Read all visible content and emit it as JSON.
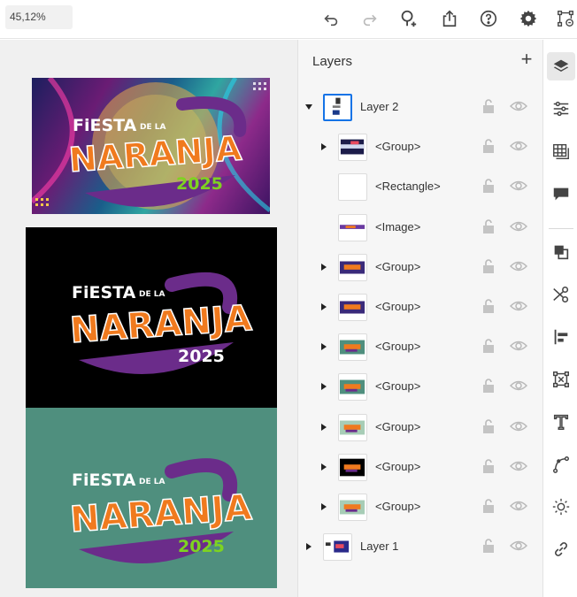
{
  "toolbar": {
    "zoom_value": "45,12%",
    "icons": [
      "undo-icon",
      "redo-icon",
      "add-user-icon",
      "share-icon",
      "help-icon",
      "settings-icon",
      "path-select-icon"
    ]
  },
  "artboards": {
    "poster1": {
      "line1": "FiESTA",
      "line1_small": "DE LA",
      "line2": "NARANJA",
      "line3": "2025"
    },
    "poster2": {
      "line1": "FiESTA",
      "line1_small": "DE LA",
      "line2": "NARANJA",
      "line3": "2025"
    },
    "poster3": {
      "line1": "FiESTA",
      "line1_small": "DE LA",
      "line2": "NARANJA",
      "line3": "2025"
    }
  },
  "layers": {
    "title": "Layers",
    "add_icon": "plus-icon",
    "rows": [
      {
        "label": "Layer 2",
        "indent": 0,
        "expanded": true,
        "has_chevron": true,
        "selected": true,
        "thumb": "layer2"
      },
      {
        "label": "<Group>",
        "indent": 1,
        "expanded": false,
        "has_chevron": true,
        "thumb": "group-dark"
      },
      {
        "label": "<Rectangle>",
        "indent": 1,
        "expanded": false,
        "has_chevron": false,
        "thumb": "blank"
      },
      {
        "label": "<Image>",
        "indent": 1,
        "expanded": false,
        "has_chevron": false,
        "thumb": "image-strip"
      },
      {
        "label": "<Group>",
        "indent": 1,
        "expanded": false,
        "has_chevron": true,
        "thumb": "poster-color"
      },
      {
        "label": "<Group>",
        "indent": 1,
        "expanded": false,
        "has_chevron": true,
        "thumb": "poster-color"
      },
      {
        "label": "<Group>",
        "indent": 1,
        "expanded": false,
        "has_chevron": true,
        "thumb": "poster-green"
      },
      {
        "label": "<Group>",
        "indent": 1,
        "expanded": false,
        "has_chevron": true,
        "thumb": "poster-green"
      },
      {
        "label": "<Group>",
        "indent": 1,
        "expanded": false,
        "has_chevron": true,
        "thumb": "poster-pale"
      },
      {
        "label": "<Group>",
        "indent": 1,
        "expanded": false,
        "has_chevron": true,
        "thumb": "poster-black"
      },
      {
        "label": "<Group>",
        "indent": 1,
        "expanded": false,
        "has_chevron": true,
        "thumb": "poster-pale"
      },
      {
        "label": "Layer 1",
        "indent": 0,
        "expanded": false,
        "has_chevron": true,
        "thumb": "layer1"
      }
    ]
  },
  "right_rail": {
    "icons": [
      "layers-icon",
      "properties-icon",
      "libraries-icon",
      "comments-icon",
      "pathfinder-icon",
      "scissors-icon",
      "align-icon",
      "transform-icon",
      "type-icon",
      "pen-curve-icon",
      "gear-puzzle-icon",
      "link-icon"
    ],
    "active_index": 0
  },
  "colors": {
    "accent": "#1473e6",
    "orange": "#f07a1e",
    "purple": "#6b2c8a",
    "green": "#7ed321",
    "teal": "#4f8f7e"
  }
}
